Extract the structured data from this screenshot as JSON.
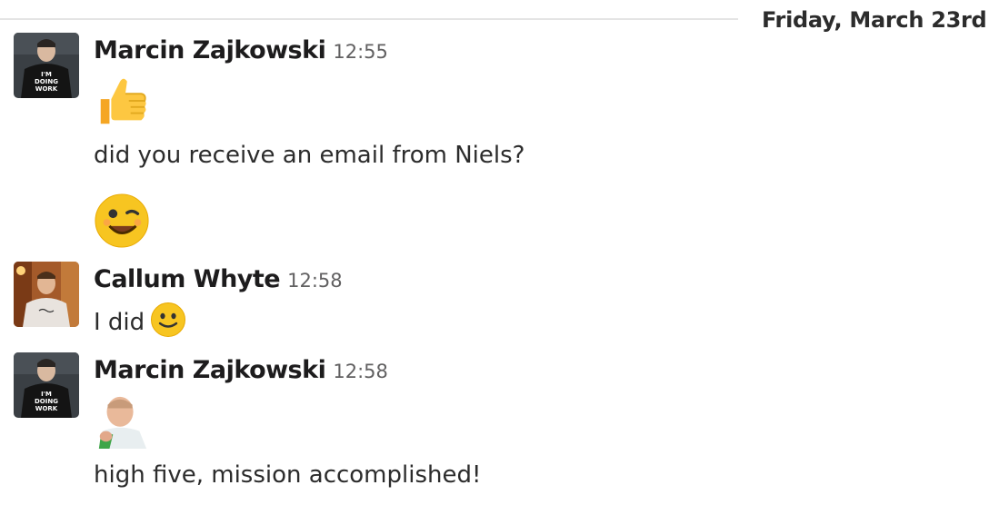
{
  "day_divider": {
    "label": "Friday, March 23rd"
  },
  "messages": [
    {
      "author": "Marcin Zajkowski",
      "time": "12:55",
      "avatar_shirt_text": "I'M DOING WORK",
      "items": [
        {
          "type": "emoji",
          "name": "thumbs-up-icon"
        },
        {
          "type": "text",
          "text": "did you receive an email from Niels?"
        },
        {
          "type": "emoji",
          "name": "wink-face-icon"
        }
      ]
    },
    {
      "author": "Callum Whyte",
      "time": "12:58",
      "text": "I did",
      "inline_emoji": "slightly-smiling-face-icon"
    },
    {
      "author": "Marcin Zajkowski",
      "time": "12:58",
      "avatar_shirt_text": "I'M DOING WORK",
      "items": [
        {
          "type": "emoji",
          "name": "success-kid-icon"
        },
        {
          "type": "text",
          "text": "high five, mission accomplished!"
        }
      ]
    }
  ],
  "colors": {
    "author": "#1d1c1d",
    "timestamp": "#616061",
    "divider": "#e4e4e4",
    "emoji_yellow": "#f7c521"
  }
}
